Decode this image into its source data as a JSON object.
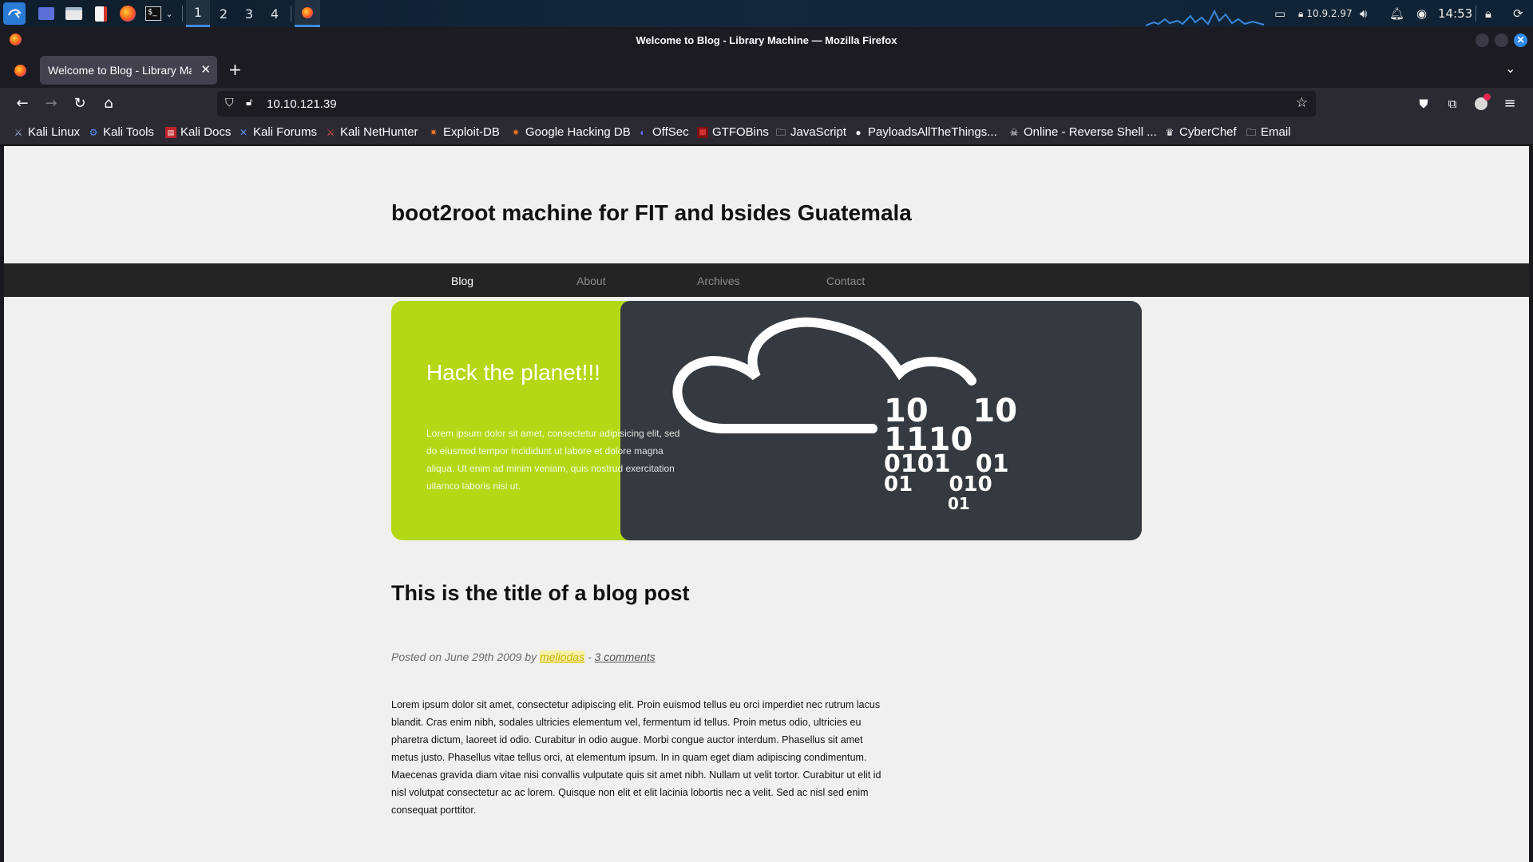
{
  "taskbar": {
    "workspaces": [
      "1",
      "2",
      "3",
      "4"
    ],
    "active_workspace": "1",
    "vpn_ip": "10.9.2.97",
    "clock": "14:53"
  },
  "window": {
    "title": "Welcome to Blog - Library Machine — Mozilla Firefox"
  },
  "browser": {
    "tab_title": "Welcome to Blog - Library Machine",
    "url": "10.10.121.39",
    "bookmarks": [
      {
        "label": "Kali Linux",
        "icon": "kali-icon"
      },
      {
        "label": "Kali Tools",
        "icon": "kali-tools-icon"
      },
      {
        "label": "Kali Docs",
        "icon": "kali-docs-icon"
      },
      {
        "label": "Kali Forums",
        "icon": "kali-forums-icon"
      },
      {
        "label": "Kali NetHunter",
        "icon": "nethunter-icon"
      },
      {
        "label": "Exploit-DB",
        "icon": "exploit-db-icon"
      },
      {
        "label": "Google Hacking DB",
        "icon": "ghdb-icon"
      },
      {
        "label": "OffSec",
        "icon": "offsec-icon"
      },
      {
        "label": "GTFOBins",
        "icon": "gtfobins-icon"
      },
      {
        "label": "JavaScript",
        "icon": "folder-icon"
      },
      {
        "label": "PayloadsAllTheThings...",
        "icon": "github-icon"
      },
      {
        "label": "Online - Reverse Shell ...",
        "icon": "skull-icon"
      },
      {
        "label": "CyberChef",
        "icon": "chef-icon"
      },
      {
        "label": "Email",
        "icon": "folder-icon"
      }
    ]
  },
  "site": {
    "title": "boot2root machine for FIT and bsides Guatemala",
    "nav": [
      "Blog",
      "About",
      "Archives",
      "Contact"
    ],
    "hero": {
      "heading": "Hack the planet!!!",
      "text": "Lorem ipsum dolor sit amet, consectetur adipisicing elit, sed do eiusmod tempor incididunt ut labore et dolore magna aliqua. Ut enim ad minim veniam, quis nostrud exercitation ullamco laboris nisi ut.",
      "binary_lines": [
        "10    10",
        "1110",
        "0101   01",
        "01     010",
        "01"
      ]
    },
    "post": {
      "title": "This is the title of a blog post",
      "meta_prefix": "Posted on June 29th 2009 by",
      "author": "meliodas",
      "separator": "-",
      "comments": "3 comments",
      "body": "Lorem ipsum dolor sit amet, consectetur adipiscing elit. Proin euismod tellus eu orci imperdiet nec rutrum lacus blandit. Cras enim nibh, sodales ultricies elementum vel, fermentum id tellus. Proin metus odio, ultricies eu pharetra dictum, laoreet id odio. Curabitur in odio augue. Morbi congue auctor interdum. Phasellus sit amet metus justo. Phasellus vitae tellus orci, at elementum ipsum. In in quam eget diam adipiscing condimentum. Maecenas gravida diam vitae nisi convallis vulputate quis sit amet nibh. Nullam ut velit tortor. Curabitur ut elit id nisl volutpat consectetur ac ac lorem. Quisque non elit et elit lacinia lobortis nec a velit. Sed ac nisl sed enim consequat porttitor."
    }
  }
}
